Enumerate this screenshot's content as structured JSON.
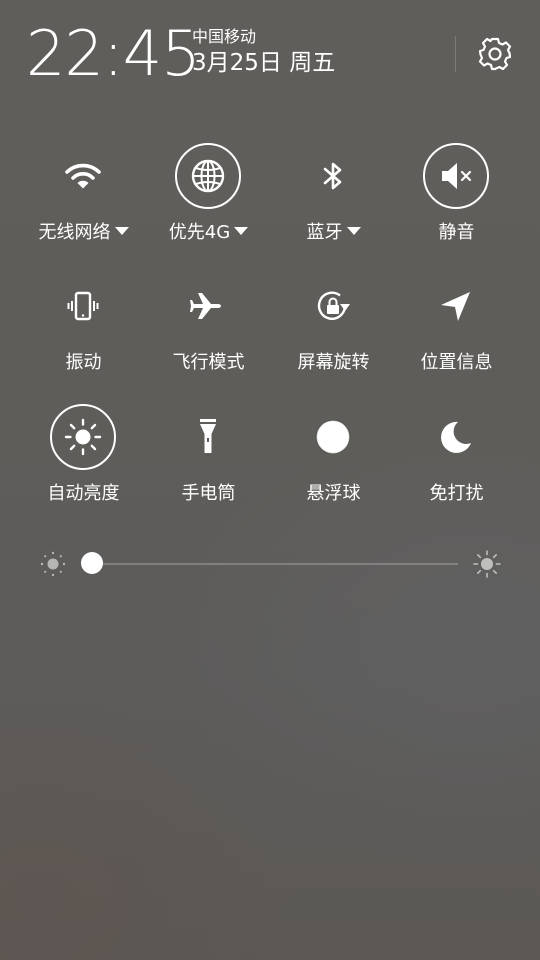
{
  "status": {
    "time": "22:45",
    "carrier": "中国移动",
    "date": "3月25日 周五"
  },
  "header": {
    "settings_icon": "gear-icon"
  },
  "tiles": [
    {
      "label": "无线网络",
      "icon": "wifi-icon",
      "dropdown": true
    },
    {
      "label": "优先4G",
      "icon": "globe-icon",
      "dropdown": true,
      "active": true
    },
    {
      "label": "蓝牙",
      "icon": "bluetooth-icon",
      "dropdown": true
    },
    {
      "label": "静音",
      "icon": "mute-icon",
      "active": true
    },
    {
      "label": "振动",
      "icon": "vibrate-icon"
    },
    {
      "label": "飞行模式",
      "icon": "airplane-icon"
    },
    {
      "label": "屏幕旋转",
      "icon": "rotation-lock-icon"
    },
    {
      "label": "位置信息",
      "icon": "location-arrow-icon"
    },
    {
      "label": "自动亮度",
      "icon": "sun-icon",
      "active": true
    },
    {
      "label": "手电筒",
      "icon": "flashlight-icon"
    },
    {
      "label": "悬浮球",
      "icon": "floating-ball-icon"
    },
    {
      "label": "免打扰",
      "icon": "moon-icon"
    }
  ],
  "brightness": {
    "level": 0.0,
    "low_icon": "brightness-low-icon",
    "high_icon": "brightness-high-icon"
  },
  "colors": {
    "foreground": "#ffffff",
    "background": "#5f5d59"
  }
}
